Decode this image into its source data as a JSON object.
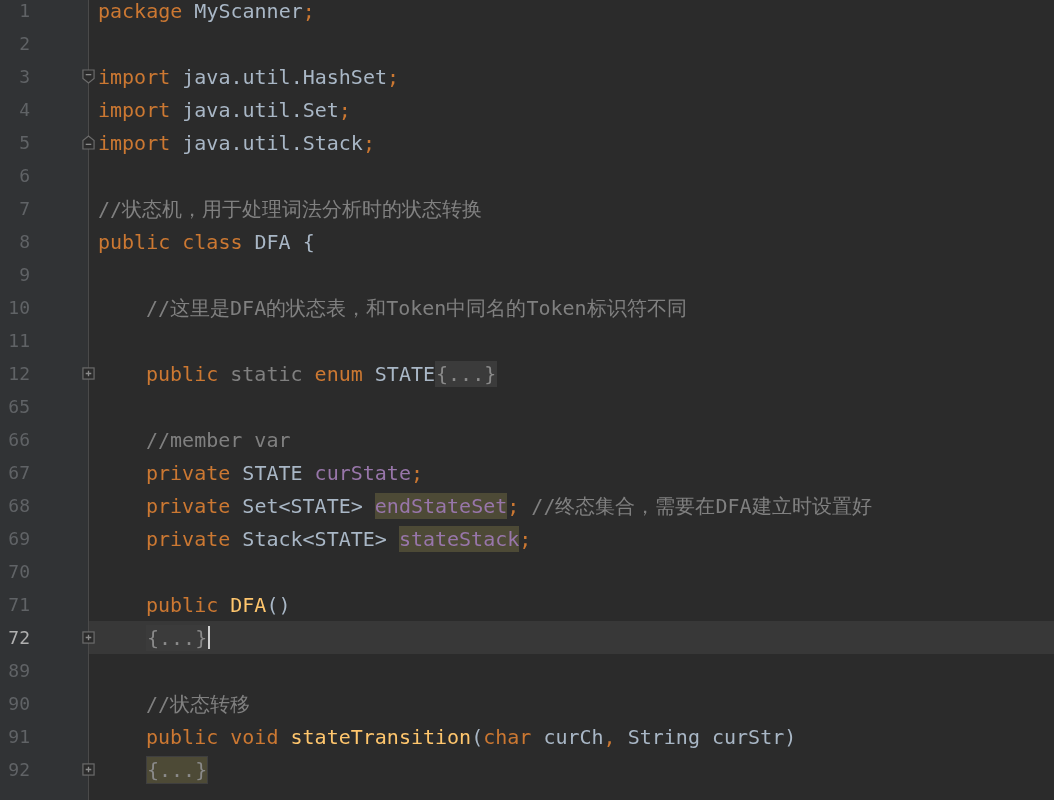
{
  "editor": {
    "lines": [
      {
        "number": "1",
        "kind": "line",
        "current": false,
        "indented": false,
        "caret": false,
        "tokens": [
          {
            "text": "package",
            "kind": "keyword"
          },
          {
            "text": " MyScanner",
            "kind": "plain"
          },
          {
            "text": ";",
            "kind": "punct"
          }
        ]
      },
      {
        "number": "2",
        "kind": "line",
        "current": false,
        "caret": false
      },
      {
        "number": "3",
        "kind": "fold-open",
        "current": false,
        "indented": false,
        "caret": false,
        "tokens": [
          {
            "text": "import",
            "kind": "keyword"
          },
          {
            "text": " java.util.HashSet",
            "kind": "plain"
          },
          {
            "text": ";",
            "kind": "punct"
          }
        ]
      },
      {
        "number": "4",
        "kind": "line",
        "current": false,
        "indented": false,
        "caret": false,
        "tokens": [
          {
            "text": "import",
            "kind": "keyword"
          },
          {
            "text": " java.util.Set",
            "kind": "plain"
          },
          {
            "text": ";",
            "kind": "punct"
          }
        ]
      },
      {
        "number": "5",
        "kind": "fold-close",
        "current": false,
        "indented": false,
        "caret": false,
        "tokens": [
          {
            "text": "import",
            "kind": "keyword"
          },
          {
            "text": " java.util.Stack",
            "kind": "plain"
          },
          {
            "text": ";",
            "kind": "punct"
          }
        ]
      },
      {
        "number": "6",
        "kind": "line",
        "current": false,
        "caret": false
      },
      {
        "number": "7",
        "kind": "line",
        "current": false,
        "indented": false,
        "caret": false,
        "tokens": [
          {
            "text": "//状态机，用于处理词法分析时的状态转换",
            "kind": "comment"
          }
        ]
      },
      {
        "number": "8",
        "kind": "line",
        "current": false,
        "indented": false,
        "caret": false,
        "tokens": [
          {
            "text": "public",
            "kind": "keyword"
          },
          {
            "text": " class",
            "kind": "keyword"
          },
          {
            "text": " DFA {",
            "kind": "plain"
          }
        ]
      },
      {
        "number": "9",
        "kind": "line",
        "current": false,
        "caret": false
      },
      {
        "number": "10",
        "kind": "line",
        "current": false,
        "indented": true,
        "caret": false,
        "tokens": [
          {
            "text": "//这里是DFA的状态表，和Token中同名的Token标识符不同",
            "kind": "comment"
          }
        ]
      },
      {
        "number": "11",
        "kind": "line",
        "current": false,
        "caret": false
      },
      {
        "number": "12",
        "kind": "collapsed",
        "current": false,
        "indented": true,
        "caret": false,
        "tokens": [
          {
            "text": "public",
            "kind": "keyword"
          },
          {
            "text": " static",
            "kind": "muted"
          },
          {
            "text": " enum",
            "kind": "keyword"
          },
          {
            "text": " STATE",
            "kind": "plain"
          },
          {
            "text": "{...}",
            "kind": "folded"
          }
        ]
      },
      {
        "number": "65",
        "kind": "line",
        "current": false,
        "caret": false
      },
      {
        "number": "66",
        "kind": "line",
        "current": false,
        "indented": true,
        "caret": false,
        "tokens": [
          {
            "text": "//member var",
            "kind": "comment"
          }
        ]
      },
      {
        "number": "67",
        "kind": "line",
        "current": false,
        "indented": true,
        "caret": false,
        "tokens": [
          {
            "text": "private",
            "kind": "keyword"
          },
          {
            "text": " STATE ",
            "kind": "plain"
          },
          {
            "text": "curState",
            "kind": "field"
          },
          {
            "text": ";",
            "kind": "punct"
          }
        ]
      },
      {
        "number": "68",
        "kind": "line",
        "current": false,
        "indented": true,
        "caret": false,
        "tokens": [
          {
            "text": "private",
            "kind": "keyword"
          },
          {
            "text": " Set<STATE> ",
            "kind": "plain"
          },
          {
            "text": "endStateSet",
            "kind": "field-marked"
          },
          {
            "text": ";",
            "kind": "punct"
          },
          {
            "text": " //终态集合，需要在DFA建立时设置好",
            "kind": "comment"
          }
        ]
      },
      {
        "number": "69",
        "kind": "line",
        "current": false,
        "indented": true,
        "caret": false,
        "tokens": [
          {
            "text": "private",
            "kind": "keyword"
          },
          {
            "text": " Stack<STATE> ",
            "kind": "plain"
          },
          {
            "text": "stateStack",
            "kind": "field-marked"
          },
          {
            "text": ";",
            "kind": "punct"
          }
        ]
      },
      {
        "number": "70",
        "kind": "line",
        "current": false,
        "caret": false
      },
      {
        "number": "71",
        "kind": "line",
        "current": false,
        "indented": true,
        "caret": false,
        "tokens": [
          {
            "text": "public",
            "kind": "keyword"
          },
          {
            "text": " DFA",
            "kind": "method"
          },
          {
            "text": "()",
            "kind": "plain"
          }
        ]
      },
      {
        "number": "72",
        "kind": "collapsed",
        "current": true,
        "indented": true,
        "caret": true,
        "tokens": [
          {
            "text": "{...}",
            "kind": "folded"
          }
        ]
      },
      {
        "number": "89",
        "kind": "line",
        "current": false,
        "caret": false
      },
      {
        "number": "90",
        "kind": "line",
        "current": false,
        "indented": true,
        "caret": false,
        "tokens": [
          {
            "text": "//状态转移",
            "kind": "comment"
          }
        ]
      },
      {
        "number": "91",
        "kind": "line",
        "current": false,
        "indented": true,
        "caret": false,
        "tokens": [
          {
            "text": "public",
            "kind": "keyword"
          },
          {
            "text": " void",
            "kind": "keyword"
          },
          {
            "text": " stateTransition",
            "kind": "method"
          },
          {
            "text": "(",
            "kind": "plain"
          },
          {
            "text": "char",
            "kind": "keyword"
          },
          {
            "text": " curCh",
            "kind": "plain"
          },
          {
            "text": ",",
            "kind": "punct"
          },
          {
            "text": " String curStr)",
            "kind": "plain"
          }
        ]
      },
      {
        "number": "92",
        "kind": "collapsed",
        "current": false,
        "indented": true,
        "caret": false,
        "tokens": [
          {
            "text": "{...}",
            "kind": "folded-marked"
          }
        ]
      }
    ]
  }
}
